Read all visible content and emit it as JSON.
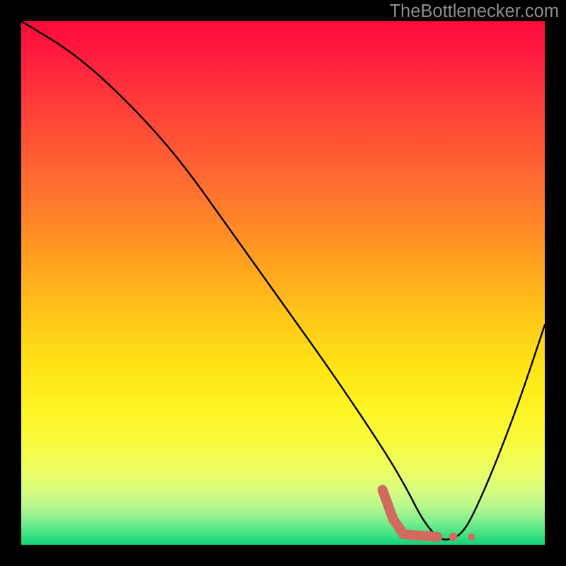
{
  "watermark": "TheBottlenecker.com",
  "chart_data": {
    "type": "line",
    "title": "",
    "xlabel": "",
    "ylabel": "",
    "xlim": [
      0,
      100
    ],
    "ylim": [
      0,
      100
    ],
    "series": [
      {
        "name": "curve",
        "x": [
          0,
          10,
          20,
          30,
          40,
          50,
          60,
          70,
          74,
          76,
          78,
          80,
          82,
          84,
          86,
          90,
          95,
          100
        ],
        "y": [
          100,
          94,
          85,
          74,
          60,
          46,
          32,
          17,
          10,
          6,
          3,
          1,
          1,
          2,
          5,
          14,
          27,
          42
        ]
      }
    ],
    "annotations": [
      {
        "name": "red-blob",
        "type": "path",
        "stroke": "#d16b5f",
        "stroke_width": 14,
        "points": [
          {
            "x": 69.0,
            "y": 10.5
          },
          {
            "x": 71.0,
            "y": 5.0
          },
          {
            "x": 73.0,
            "y": 2.0
          },
          {
            "x": 79.5,
            "y": 1.5
          }
        ]
      },
      {
        "name": "red-dot-1",
        "type": "dot",
        "fill": "#d16b5f",
        "r": 6,
        "x": 82.5,
        "y": 1.5
      },
      {
        "name": "red-dot-2",
        "type": "dot",
        "fill": "#d16b5f",
        "r": 5,
        "x": 86.0,
        "y": 1.5
      }
    ],
    "background_gradient": {
      "stops": [
        {
          "offset": 0.0,
          "color": "#ff0a3a"
        },
        {
          "offset": 0.06,
          "color": "#ff1a3e"
        },
        {
          "offset": 0.15,
          "color": "#ff3a3a"
        },
        {
          "offset": 0.25,
          "color": "#ff5a33"
        },
        {
          "offset": 0.35,
          "color": "#ff7a2c"
        },
        {
          "offset": 0.45,
          "color": "#ff9e20"
        },
        {
          "offset": 0.55,
          "color": "#ffc21a"
        },
        {
          "offset": 0.65,
          "color": "#ffe115"
        },
        {
          "offset": 0.73,
          "color": "#fff220"
        },
        {
          "offset": 0.8,
          "color": "#f8fb3a"
        },
        {
          "offset": 0.86,
          "color": "#ecfd63"
        },
        {
          "offset": 0.9,
          "color": "#d5fb82"
        },
        {
          "offset": 0.93,
          "color": "#b2f68e"
        },
        {
          "offset": 0.955,
          "color": "#7fee8e"
        },
        {
          "offset": 0.975,
          "color": "#4de586"
        },
        {
          "offset": 0.99,
          "color": "#28da7e"
        },
        {
          "offset": 1.0,
          "color": "#17d178"
        }
      ]
    },
    "curve_color": "#000000",
    "curve_width": 2.4
  }
}
